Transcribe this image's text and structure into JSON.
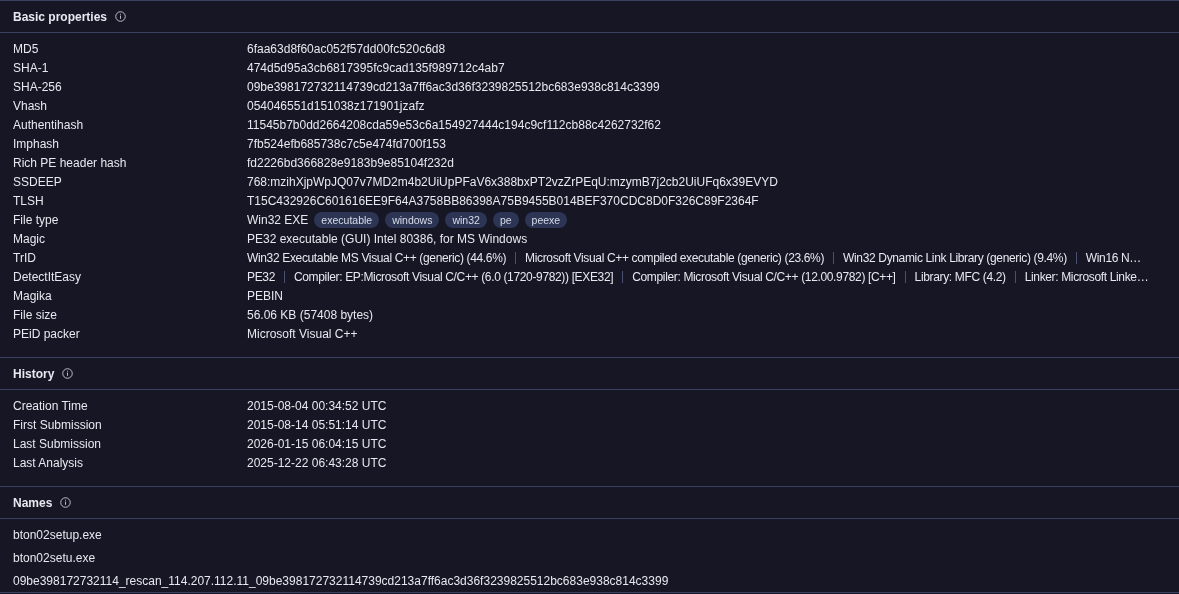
{
  "sections": [
    {
      "title": "Basic properties",
      "kind": "properties",
      "rows": [
        {
          "label": "MD5",
          "kind": "text",
          "value": "6faa63d8f60ac052f57dd00fc520c6d8"
        },
        {
          "label": "SHA-1",
          "kind": "text",
          "value": "474d5d95a3cb6817395fc9cad135f989712c4ab7"
        },
        {
          "label": "SHA-256",
          "kind": "text",
          "value": "09be398172732114739cd213a7ff6ac3d36f3239825512bc683e938c814c3399"
        },
        {
          "label": "Vhash",
          "kind": "text",
          "value": "054046551d151038z171901jzafz"
        },
        {
          "label": "Authentihash",
          "kind": "text",
          "value": "11545b7b0dd2664208cda59e53c6a154927444c194c9cf112cb88c4262732f62"
        },
        {
          "label": "Imphash",
          "kind": "text",
          "value": "7fb524efb685738c7c5e474fd700f153"
        },
        {
          "label": "Rich PE header hash",
          "kind": "text",
          "value": "fd2226bd366828e9183b9e85104f232d"
        },
        {
          "label": "SSDEEP",
          "kind": "text",
          "value": "768:mzihXjpWpJQ07v7MD2m4b2UiUpPFaV6x388bxPT2vzZrPEqU:mzymB7j2cb2UiUFq6x39EVYD"
        },
        {
          "label": "TLSH",
          "kind": "text",
          "value": "T15C432926C601616EE9F64A3758BB86398A75B9455B014BEF370CDC8D0F326C89F2364F"
        },
        {
          "label": "File type",
          "kind": "tags",
          "value": "Win32 EXE",
          "tags": [
            "executable",
            "windows",
            "win32",
            "pe",
            "peexe"
          ]
        },
        {
          "label": "Magic",
          "kind": "text",
          "value": "PE32 executable (GUI) Intel 80386, for MS Windows"
        },
        {
          "label": "TrID",
          "kind": "parts",
          "parts": [
            "Win32 Executable MS Visual C++ (generic) (44.6%)",
            "Microsoft Visual C++ compiled executable (generic) (23.6%)",
            "Win32 Dynamic Link Library (generic) (9.4%)",
            "Win16 N…"
          ]
        },
        {
          "label": "DetectItEasy",
          "kind": "parts",
          "parts": [
            "PE32",
            "Compiler: EP:Microsoft Visual C/C++ (6.0 (1720-9782)) [EXE32]",
            "Compiler: Microsoft Visual C/C++ (12.00.9782) [C++]",
            "Library: MFC (4.2)",
            "Linker: Microsoft Linke…"
          ]
        },
        {
          "label": "Magika",
          "kind": "text",
          "value": "PEBIN"
        },
        {
          "label": "File size",
          "kind": "text",
          "value": "56.06 KB (57408 bytes)"
        },
        {
          "label": "PEiD packer",
          "kind": "text",
          "value": "Microsoft Visual C++"
        }
      ]
    },
    {
      "title": "History",
      "kind": "properties",
      "rows": [
        {
          "label": "Creation Time",
          "kind": "text",
          "value": "2015-08-04 00:34:52 UTC"
        },
        {
          "label": "First Submission",
          "kind": "text",
          "value": "2015-08-14 05:51:14 UTC"
        },
        {
          "label": "Last Submission",
          "kind": "text",
          "value": "2026-01-15 06:04:15 UTC"
        },
        {
          "label": "Last Analysis",
          "kind": "text",
          "value": "2025-12-22 06:43:28 UTC"
        }
      ]
    },
    {
      "title": "Names",
      "kind": "names",
      "names": [
        "bton02setup.exe",
        "bton02setu.exe",
        "09be398172732114_rescan_114.207.112.11_09be398172732114739cd213a7ff6ac3d36f3239825512bc683e938c814c3399"
      ]
    }
  ]
}
